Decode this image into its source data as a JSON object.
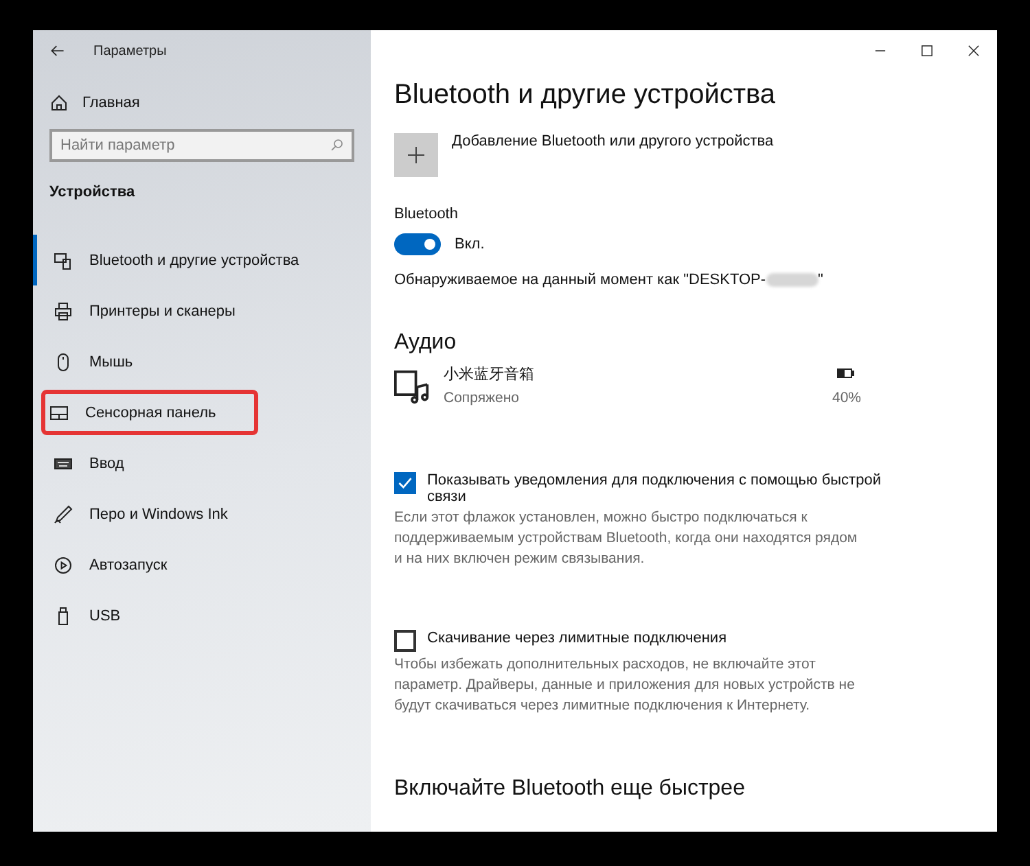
{
  "window": {
    "title": "Параметры"
  },
  "sidebar": {
    "home": "Главная",
    "search": {
      "placeholder": "Найти параметр"
    },
    "section": "Устройства",
    "items": [
      {
        "label": "Bluetooth и другие устройства",
        "selected": true,
        "highlighted": false
      },
      {
        "label": "Принтеры и сканеры",
        "selected": false,
        "highlighted": false
      },
      {
        "label": "Мышь",
        "selected": false,
        "highlighted": false
      },
      {
        "label": "Сенсорная панель",
        "selected": false,
        "highlighted": true
      },
      {
        "label": "Ввод",
        "selected": false,
        "highlighted": false
      },
      {
        "label": "Перо и Windows Ink",
        "selected": false,
        "highlighted": false
      },
      {
        "label": "Автозапуск",
        "selected": false,
        "highlighted": false
      },
      {
        "label": "USB",
        "selected": false,
        "highlighted": false
      }
    ]
  },
  "main": {
    "title": "Bluetooth и другие устройства",
    "add_device": "Добавление Bluetooth или другого устройства",
    "bluetooth": {
      "label": "Bluetooth",
      "on": true,
      "state_label": "Вкл."
    },
    "discoverable": {
      "text": "Обнаруживаемое на данный момент как \"DESKTOP-",
      "suffix": "\""
    },
    "audio": {
      "heading": "Аудио",
      "devices": [
        {
          "name": "小米蓝牙音箱",
          "status": "Сопряжено",
          "battery": "40%"
        }
      ]
    },
    "options": [
      {
        "label": "Показывать уведомления для подключения с помощью быстрой связи",
        "checked": true,
        "description": "Если этот флажок установлен, можно быстро подключаться к поддерживаемым устройствам Bluetooth, когда они находятся рядом и на них включен режим связывания."
      },
      {
        "label": "Скачивание через лимитные подключения",
        "checked": false,
        "description": "Чтобы избежать дополнительных расходов, не включайте этот параметр. Драйверы, данные и приложения для новых устройств не будут скачиваться через лимитные подключения к Интернету."
      }
    ],
    "footer_heading": "Включайте Bluetooth еще быстрее"
  }
}
